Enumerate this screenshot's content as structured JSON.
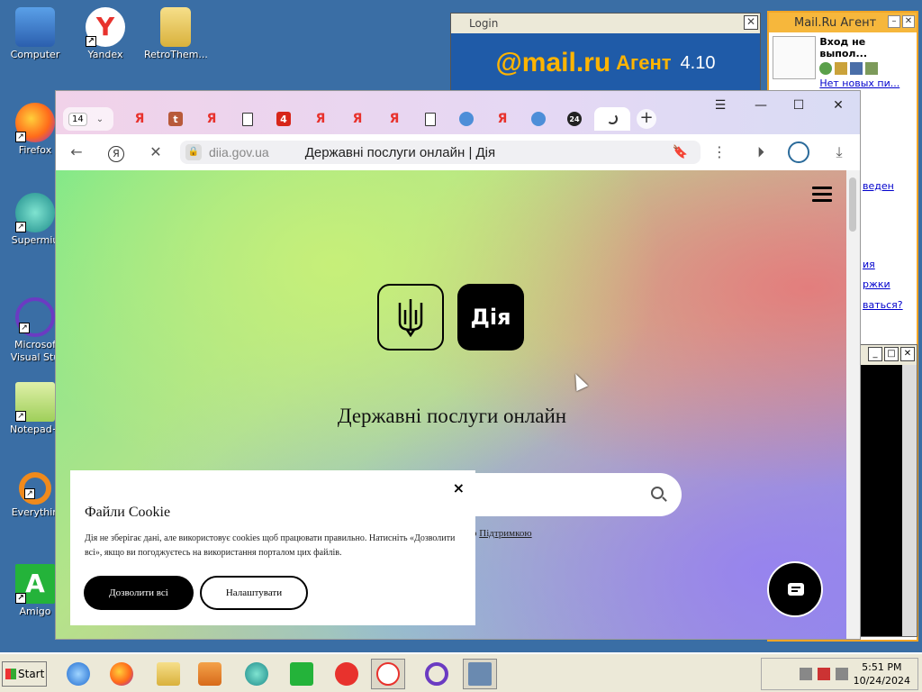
{
  "desktop": {
    "icons": [
      {
        "label": "Computer"
      },
      {
        "label": "Yandex"
      },
      {
        "label": "RetroThem..."
      },
      {
        "label": "Firefox"
      },
      {
        "label": "Supermiu"
      },
      {
        "label": "Microsof Visual Stu"
      },
      {
        "label": "Notepad+"
      },
      {
        "label": "Everythin"
      },
      {
        "label": "Amigo"
      }
    ]
  },
  "mailru_login": {
    "title": "Login",
    "brand": "@mail.ru",
    "agent_word": "Агент",
    "version": "4.10"
  },
  "mailru_agent": {
    "title": "Mail.Ru Агент",
    "status": "Вход не выпол...",
    "new_mail_link": "Нет новых пи...",
    "partial_texts": [
      "веден",
      "ия",
      "ржки",
      "ваться?"
    ]
  },
  "browser": {
    "tab_count": "14",
    "address": {
      "domain": "diia.gov.ua",
      "page_title": "Державні послуги онлайн | Дія"
    }
  },
  "page": {
    "logo_text": "Дія",
    "headline": "Державні послуги онлайн",
    "support_prefix": "о",
    "support_link": "Підтримкою",
    "cookie": {
      "title": "Файли Cookie",
      "text": "Дія не зберігає дані, але використовує cookies щоб працювати правильно. Натисніть «Дозволити всі», якщо ви погоджуєтесь на використання порталом цих файлів.",
      "allow_label": "Дозволити всі",
      "settings_label": "Налаштувати",
      "close": "×"
    }
  },
  "taskbar": {
    "start_label": "Start",
    "time": "5:51 PM",
    "date": "10/24/2024"
  }
}
